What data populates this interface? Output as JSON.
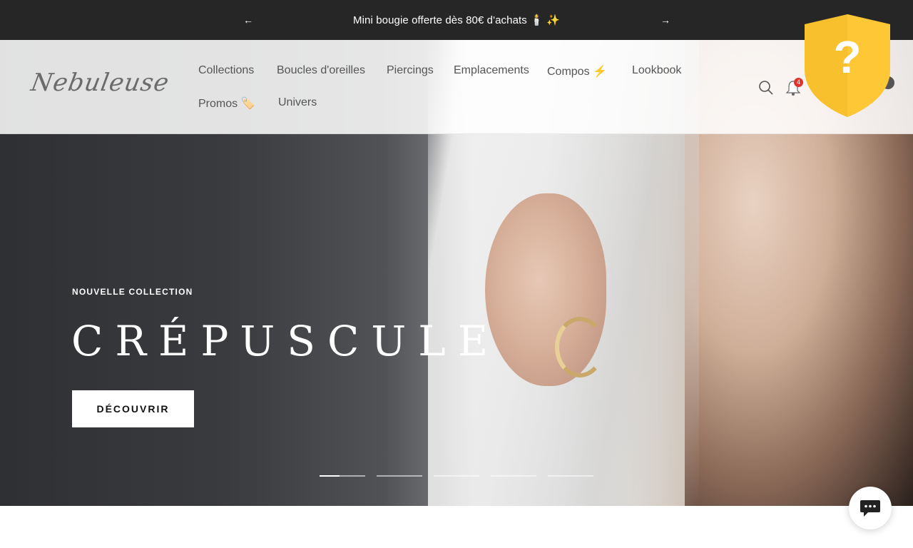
{
  "announcement": {
    "text": "Mini bougie offerte dès 80€ d'achats 🕯️ ✨",
    "prev_icon": "←",
    "next_icon": "→"
  },
  "header": {
    "logo_text": "Nebuleuse",
    "nav": [
      {
        "label": "Collections"
      },
      {
        "label": "Boucles d'oreilles"
      },
      {
        "label": "Piercings"
      },
      {
        "label": "Emplacements"
      },
      {
        "label": "Compos ⚡"
      },
      {
        "label": "Lookbook"
      },
      {
        "label": "Promos 🏷️"
      },
      {
        "label": "Univers"
      }
    ],
    "notification_count": "4",
    "icons": [
      "search-icon",
      "bell-icon",
      "cart-icon"
    ]
  },
  "shield_widget": {
    "symbol": "?",
    "color": "#F9C02E"
  },
  "hero": {
    "eyebrow": "NOUVELLE COLLECTION",
    "title": "CRÉPUSCULE",
    "cta_label": "DÉCOUVRIR",
    "slides_total": 5,
    "active_slide": 1
  },
  "chat": {
    "icon": "chat-bubble-icon",
    "label": "…"
  }
}
